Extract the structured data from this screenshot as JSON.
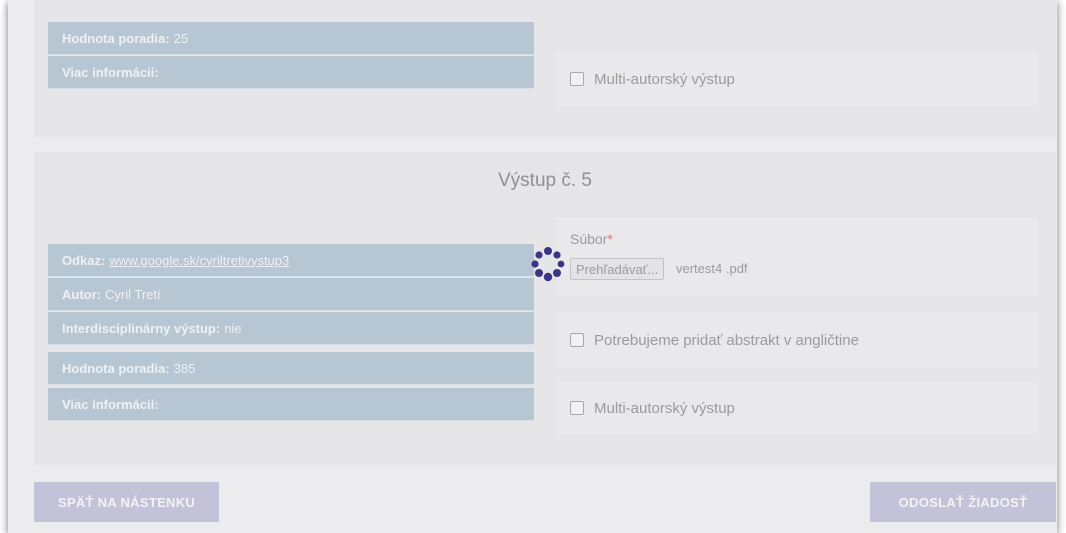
{
  "prev_output": {
    "rows": [
      {
        "label": "Hodnota poradia:",
        "value": "25"
      },
      {
        "label": "Viac informácií:",
        "value": ""
      }
    ],
    "multi_author_label": "Multi-autorský výstup"
  },
  "output5": {
    "title": "Výstup č. 5",
    "link_label": "Odkaz:",
    "link_value": "www.google.sk/cyriltretivystup3",
    "rows": [
      {
        "label": "Autor:",
        "value": "Cyril Tretí"
      },
      {
        "label": "Interdisciplinárny výstup:",
        "value": "nie"
      },
      {
        "label": "Hodnota poradia:",
        "value": "385"
      },
      {
        "label": "Viac informácií:",
        "value": ""
      }
    ],
    "file_label": "Súbor",
    "required_mark": "*",
    "browse_label": "Prehľadávať...",
    "file_name": "vertest4 .pdf",
    "abstract_label": "Potrebujeme pridať abstrakt v angličtine",
    "multi_author_label": "Multi-autorský výstup"
  },
  "footer": {
    "back_label": "SPÄŤ NA NÁSTENKU",
    "submit_label": "ODOSLAŤ ŽIADOSŤ"
  },
  "colors": {
    "info_row_bg": "#b6c6d2",
    "button_bg": "#c4c2d8",
    "spinner": "#3a3585",
    "required": "#d47b80"
  },
  "icons": [
    "checkbox-icon",
    "loading-spinner-icon"
  ]
}
